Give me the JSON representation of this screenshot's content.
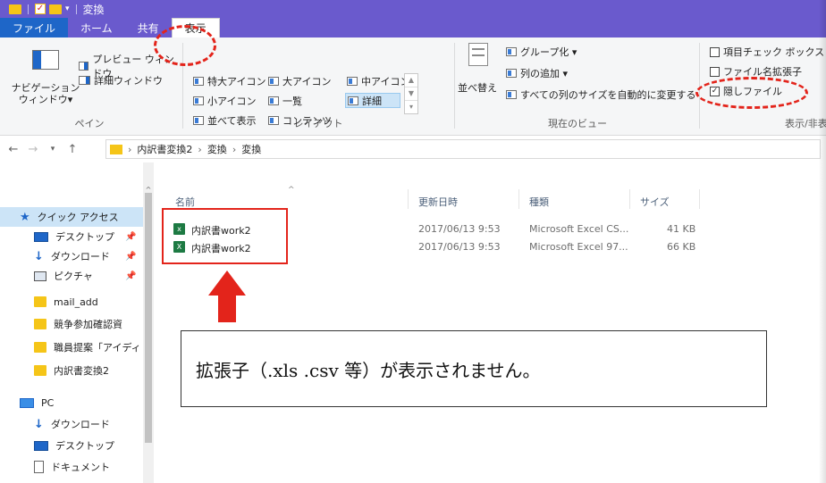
{
  "titlebar": {
    "title": "変換"
  },
  "tabs": [
    "ファイル",
    "ホーム",
    "共有",
    "表示"
  ],
  "ribbon": {
    "pane": {
      "nav_pane": "ナビゲーション\nウィンドウ▾",
      "preview": "プレビュー ウィンドウ",
      "details": "詳細ウィンドウ",
      "label": "ペイン"
    },
    "layout": {
      "items": [
        "特大アイコン",
        "大アイコン",
        "中アイコン",
        "小アイコン",
        "一覧",
        "詳細",
        "並べて表示",
        "コンテンツ"
      ],
      "label": "レイアウト"
    },
    "current_view": {
      "sort": "並べ替え",
      "group": "グループ化 ▾",
      "add_column": "列の追加 ▾",
      "fit_columns": "すべての列のサイズを自動的に変更する",
      "label": "現在のビュー"
    },
    "show_hide": {
      "item_checkbox": "項目チェック ボックス",
      "extensions": "ファイル名拡張子",
      "hidden": "隠しファイル",
      "label": "表示/非表示"
    }
  },
  "address": {
    "path": [
      "内訳書変換2",
      "変換",
      "変換"
    ]
  },
  "nav": [
    {
      "label": "クイック アクセス",
      "icon": "star-icon"
    },
    {
      "label": "デスクトップ",
      "icon": "desktop-icon",
      "pinned": true
    },
    {
      "label": "ダウンロード",
      "icon": "download-icon",
      "pinned": true
    },
    {
      "label": "ピクチャ",
      "icon": "pictures-icon",
      "pinned": true
    },
    {
      "label": "mail_add",
      "icon": "folder-icon"
    },
    {
      "label": "競争参加確認資",
      "icon": "folder-icon"
    },
    {
      "label": "職員提案「アイディ",
      "icon": "folder-icon"
    },
    {
      "label": "内訳書変換2",
      "icon": "folder-icon"
    },
    {
      "label": "PC",
      "icon": "pc-icon"
    },
    {
      "label": "ダウンロード",
      "icon": "download-icon"
    },
    {
      "label": "デスクトップ",
      "icon": "desktop-icon"
    },
    {
      "label": "ドキュメント",
      "icon": "documents-icon"
    }
  ],
  "columns": {
    "name": "名前",
    "date": "更新日時",
    "type": "種類",
    "size": "サイズ"
  },
  "files": [
    {
      "name": "内訳書work2",
      "date": "2017/06/13 9:53",
      "type": "Microsoft Excel CS...",
      "size": "41 KB",
      "icon": "excel-csv-icon"
    },
    {
      "name": "内訳書work2",
      "date": "2017/06/13 9:53",
      "type": "Microsoft Excel 97...",
      "size": "66 KB",
      "icon": "excel-xls-icon"
    }
  ],
  "callout": "拡張子（.xls .csv 等）が表示されません。",
  "colors": {
    "titlebar": "#6a5acd",
    "file_tab": "#1e66c8",
    "annotation": "#e3241b",
    "selection": "#cce4f7"
  }
}
